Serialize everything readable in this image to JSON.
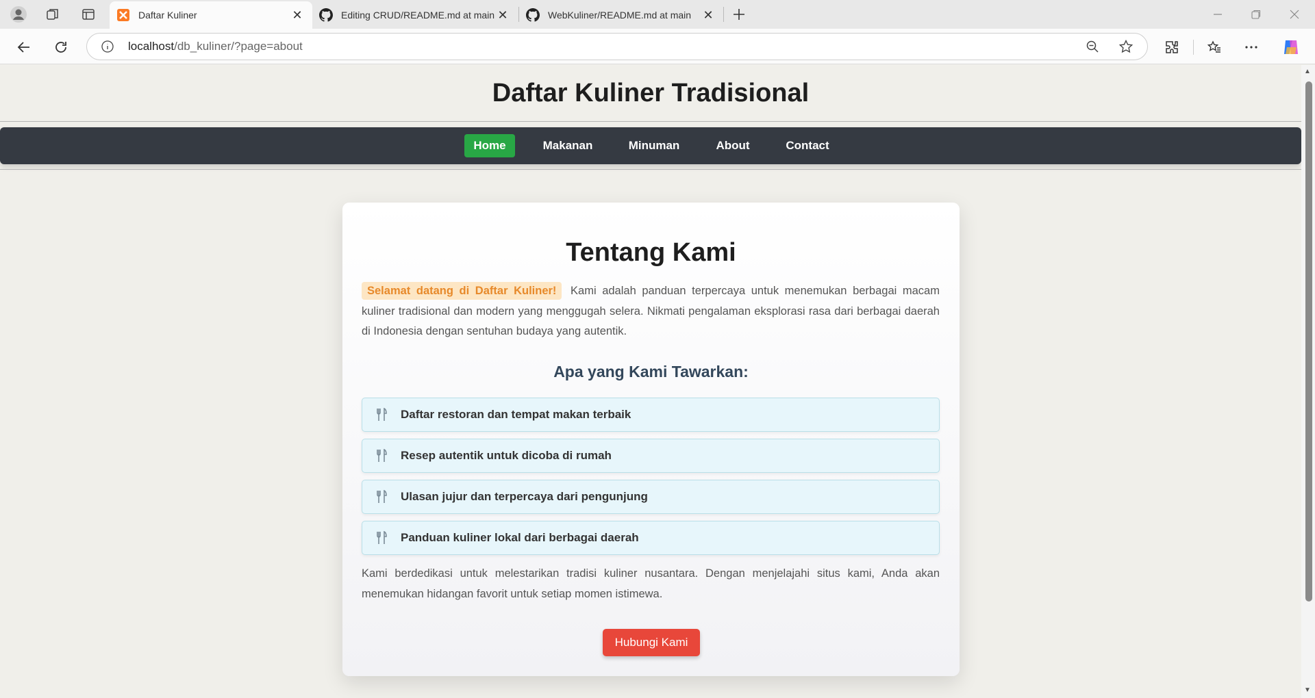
{
  "browser": {
    "tabs": [
      {
        "title": "Daftar Kuliner",
        "favicon": "xampp-icon",
        "active": true
      },
      {
        "title": "Editing CRUD/README.md at main",
        "favicon": "github-icon",
        "active": false
      },
      {
        "title": "WebKuliner/README.md at main",
        "favicon": "github-icon",
        "active": false
      }
    ],
    "url_host": "localhost",
    "url_path": "/db_kuliner/?page=about"
  },
  "site": {
    "title": "Daftar Kuliner Tradisional",
    "nav": [
      {
        "label": "Home",
        "active": true
      },
      {
        "label": "Makanan",
        "active": false
      },
      {
        "label": "Minuman",
        "active": false
      },
      {
        "label": "About",
        "active": false
      },
      {
        "label": "Contact",
        "active": false
      }
    ],
    "nav_active_color": "#28a745"
  },
  "about": {
    "heading": "Tentang Kami",
    "welcome": "Selamat datang di Daftar Kuliner!",
    "intro": "Kami adalah panduan terpercaya untuk menemukan berbagai macam kuliner tradisional dan modern yang menggugah selera. Nikmati pengalaman eksplorasi rasa dari berbagai daerah di Indonesia dengan sentuhan budaya yang autentik.",
    "offer_heading": "Apa yang Kami Tawarkan:",
    "offers": [
      {
        "icon": "utensils-icon",
        "label": "Daftar restoran dan tempat makan terbaik"
      },
      {
        "icon": "utensils-icon",
        "label": "Resep autentik untuk dicoba di rumah"
      },
      {
        "icon": "utensils-icon",
        "label": "Ulasan jujur dan terpercaya dari pengunjung"
      },
      {
        "icon": "utensils-icon",
        "label": "Panduan kuliner lokal dari berbagai daerah"
      }
    ],
    "closing": "Kami berdedikasi untuk melestarikan tradisi kuliner nusantara. Dengan menjelajahi situs kami, Anda akan menemukan hidangan favorit untuk setiap momen istimewa.",
    "cta_label": "Hubungi Kami",
    "cta_color": "#e8473a"
  }
}
